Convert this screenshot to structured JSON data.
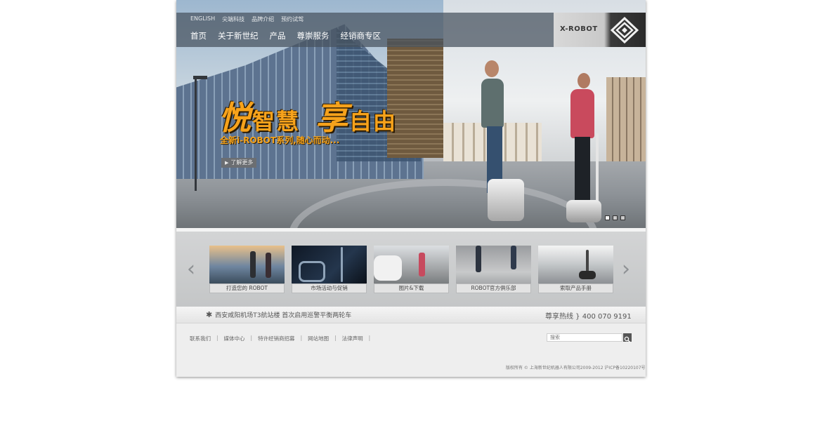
{
  "util_nav": [
    "ENGLISH",
    "尖端科技",
    "品牌介绍",
    "预约试驾"
  ],
  "main_nav": [
    "首页",
    "关于新世纪",
    "产品",
    "尊崇服务",
    "经销商专区"
  ],
  "logo": {
    "text": "X-ROBOT"
  },
  "hero": {
    "slogan_1": "悦",
    "slogan_2": "智慧",
    "slogan_3": "享",
    "slogan_4": "自由",
    "tagline": "全新i-ROBOT系列,随心而动...",
    "cta_label": "了解更多",
    "slide_count": 3,
    "active_slide": 1
  },
  "gallery": {
    "prev_icon": "‹",
    "next_icon": "›",
    "items": [
      {
        "caption": "打造您的 ROBOT"
      },
      {
        "caption": "市场活动与促销"
      },
      {
        "caption": "图片&下载"
      },
      {
        "caption": "ROBOT官方俱乐部"
      },
      {
        "caption": "索取产品手册"
      }
    ]
  },
  "news": {
    "icon": "✱",
    "text": "西安咸阳机场T3航站楼  首次启用巡警平衡两轮车"
  },
  "hotline": "尊享热线 } 400 070 9191",
  "footer": {
    "links": [
      "联系我们",
      "媒体中心",
      "特许经销商招募",
      "网站地图",
      "法律声明"
    ],
    "separator": "|",
    "search_placeholder": "搜索",
    "copyright": "版权所有 © 上海新世纪机器人有限公司2009-2012   沪ICP备10220107号"
  },
  "colors": {
    "accent": "#f6a21b",
    "nav_bg": "#46525e",
    "logo_dark": "#2a2a2a"
  }
}
